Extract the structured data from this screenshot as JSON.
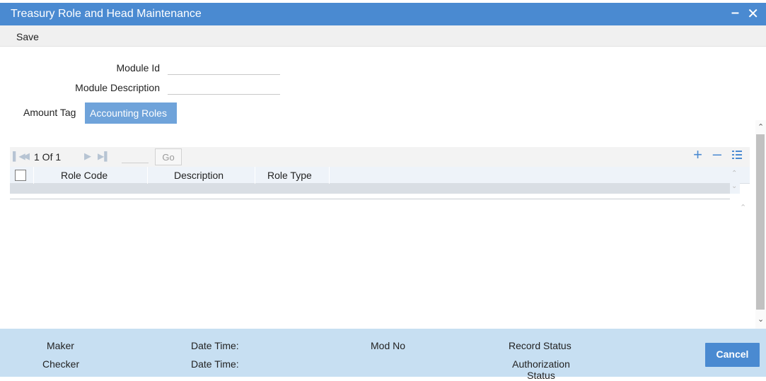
{
  "window": {
    "title": "Treasury Role and Head Maintenance",
    "minimize_glyph": "–",
    "close_glyph": "✕"
  },
  "menu": {
    "save_label": "Save"
  },
  "form": {
    "module_id_label": "Module Id",
    "module_id_value": "",
    "module_description_label": "Module Description",
    "module_description_value": ""
  },
  "tabs": [
    {
      "label": "Amount Tag",
      "active": false
    },
    {
      "label": "Accounting Roles",
      "active": true
    }
  ],
  "grid": {
    "pagination": {
      "text": "1 Of 1",
      "current_page": 1,
      "total_pages": 1,
      "page_input_value": "",
      "go_label": "Go"
    },
    "columns": [
      "Role Code",
      "Description",
      "Role Type"
    ],
    "rows": []
  },
  "footer": {
    "maker_label": "Maker",
    "checker_label": "Checker",
    "date_time_label_1": "Date Time:",
    "date_time_label_2": "Date Time:",
    "mod_no_label": "Mod No",
    "record_status_label": "Record Status",
    "authorization_status_label": "Authorization Status",
    "cancel_label": "Cancel"
  },
  "colors": {
    "accent": "#4a8ad1",
    "active_tab": "#6fa3da",
    "footer_bg": "#c7dff2"
  },
  "icons": [
    "first-page-icon",
    "prev-page-icon",
    "next-page-icon",
    "last-page-icon",
    "add-row-icon",
    "delete-row-icon",
    "column-list-icon"
  ]
}
